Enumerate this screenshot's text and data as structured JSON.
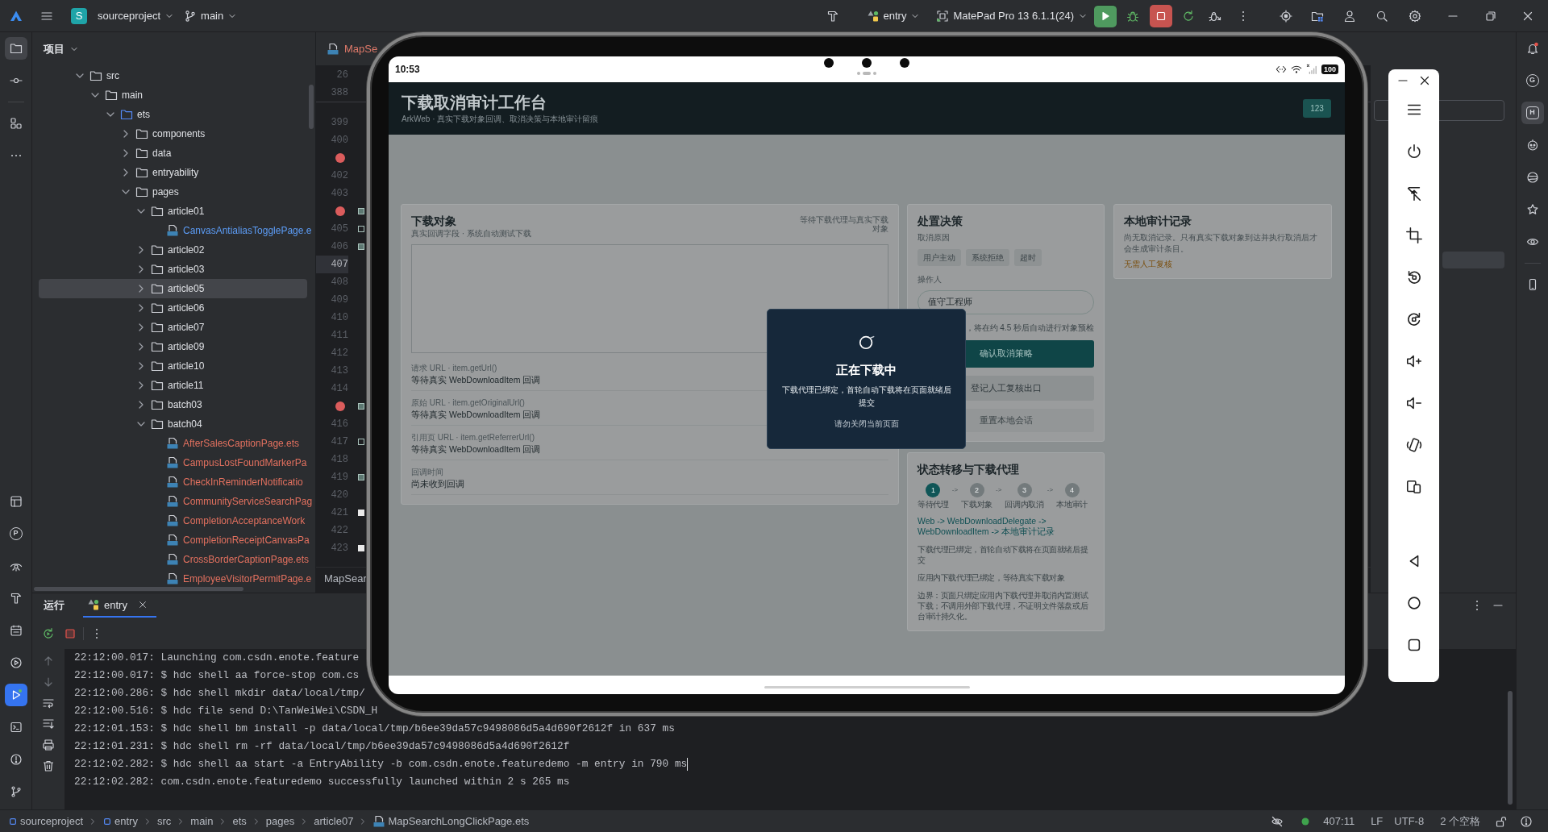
{
  "top_bar": {
    "project_letter": "S",
    "project": "sourceproject",
    "branch": "main",
    "run_config": "entry",
    "device": "MatePad Pro 13 6.1.1(24)"
  },
  "left_toolbar": {
    "top": [
      {
        "selected": true
      },
      {
        "selected": false
      },
      {
        "selected": false
      },
      {
        "selected": false
      }
    ],
    "bottom": [
      {
        "selected": false
      },
      {
        "letter": "P",
        "selected": false
      },
      {
        "selected": false
      },
      {
        "selected": false
      },
      {
        "selected": false
      },
      {
        "selected": false
      },
      {
        "selected": true
      },
      {
        "selected": false
      },
      {
        "selected": false
      },
      {
        "selected": false
      }
    ]
  },
  "project": {
    "title": "项目",
    "tree": [
      {
        "kind": "folder",
        "label": "src",
        "expanded": true,
        "selected": false,
        "children": [
          {
            "kind": "folder",
            "label": "main",
            "expanded": true,
            "selected": false,
            "children": [
              {
                "kind": "source_root",
                "label": "ets",
                "expanded": true,
                "selected": false,
                "children": [
                  {
                    "kind": "folder",
                    "label": "components",
                    "expanded": false,
                    "selected": false
                  },
                  {
                    "kind": "folder",
                    "label": "data",
                    "expanded": false,
                    "selected": false
                  },
                  {
                    "kind": "folder",
                    "label": "entryability",
                    "expanded": false,
                    "selected": false
                  },
                  {
                    "kind": "folder",
                    "label": "pages",
                    "expanded": true,
                    "selected": false,
                    "children": [
                      {
                        "kind": "folder",
                        "label": "article01",
                        "expanded": true,
                        "selected": false,
                        "children": [
                          {
                            "kind": "file",
                            "label": "CanvasAntialiasTogglePage.e",
                            "color": "#5c9cf5",
                            "selected": false
                          }
                        ]
                      },
                      {
                        "kind": "folder",
                        "label": "article02",
                        "expanded": false,
                        "selected": false
                      },
                      {
                        "kind": "folder",
                        "label": "article03",
                        "expanded": false,
                        "selected": false
                      },
                      {
                        "kind": "folder",
                        "label": "article05",
                        "expanded": false,
                        "selected": true
                      },
                      {
                        "kind": "folder",
                        "label": "article06",
                        "expanded": false,
                        "selected": false
                      },
                      {
                        "kind": "folder",
                        "label": "article07",
                        "expanded": false,
                        "selected": false
                      },
                      {
                        "kind": "folder",
                        "label": "article09",
                        "expanded": false,
                        "selected": false
                      },
                      {
                        "kind": "folder",
                        "label": "article10",
                        "expanded": false,
                        "selected": false
                      },
                      {
                        "kind": "folder",
                        "label": "article11",
                        "expanded": false,
                        "selected": false
                      },
                      {
                        "kind": "folder",
                        "label": "batch03",
                        "expanded": false,
                        "selected": false
                      },
                      {
                        "kind": "folder",
                        "label": "batch04",
                        "expanded": true,
                        "selected": false,
                        "children": [
                          {
                            "kind": "file",
                            "label": "AfterSalesCaptionPage.ets",
                            "color": "#e3715f",
                            "selected": false
                          },
                          {
                            "kind": "file",
                            "label": "CampusLostFoundMarkerPa",
                            "color": "#e3715f",
                            "selected": false
                          },
                          {
                            "kind": "file",
                            "label": "CheckInReminderNotificatio",
                            "color": "#e3715f",
                            "selected": false
                          },
                          {
                            "kind": "file",
                            "label": "CommunityServiceSearchPag",
                            "color": "#e3715f",
                            "selected": false
                          },
                          {
                            "kind": "file",
                            "label": "CompletionAcceptanceWork",
                            "color": "#e3715f",
                            "selected": false
                          },
                          {
                            "kind": "file",
                            "label": "CompletionReceiptCanvasPa",
                            "color": "#e3715f",
                            "selected": false
                          },
                          {
                            "kind": "file",
                            "label": "CrossBorderCaptionPage.ets",
                            "color": "#e3715f",
                            "selected": false
                          },
                          {
                            "kind": "file",
                            "label": "EmployeeVisitorPermitPage.e",
                            "color": "#e3715f",
                            "selected": false
                          }
                        ]
                      }
                    ]
                  }
                ]
              }
            ]
          }
        ]
      }
    ]
  },
  "editor": {
    "tab": "MapSe",
    "sticky_lines": [
      "26",
      "388"
    ],
    "gutter": [
      {
        "kind": "number",
        "text": "399",
        "current": false
      },
      {
        "kind": "number",
        "text": "400",
        "current": false
      },
      {
        "kind": "breakpoint",
        "current": false
      },
      {
        "kind": "number",
        "text": "402",
        "current": false
      },
      {
        "kind": "number",
        "text": "403",
        "current": false
      },
      {
        "kind": "breakpoint",
        "current": false,
        "marker": {
          "kind": "filled"
        }
      },
      {
        "kind": "number",
        "text": "405",
        "current": false,
        "marker": {
          "kind": "outline"
        }
      },
      {
        "kind": "number",
        "text": "406",
        "current": false,
        "marker": {
          "kind": "filled"
        }
      },
      {
        "kind": "number",
        "text": "407",
        "current": true
      },
      {
        "kind": "number",
        "text": "408",
        "current": false
      },
      {
        "kind": "number",
        "text": "409",
        "current": false
      },
      {
        "kind": "number",
        "text": "410",
        "current": false
      },
      {
        "kind": "number",
        "text": "411",
        "current": false
      },
      {
        "kind": "number",
        "text": "412",
        "current": false
      },
      {
        "kind": "number",
        "text": "413",
        "current": false
      },
      {
        "kind": "number",
        "text": "414",
        "current": false
      },
      {
        "kind": "breakpoint",
        "current": false,
        "marker": {
          "kind": "filled"
        }
      },
      {
        "kind": "number",
        "text": "416",
        "current": false
      },
      {
        "kind": "number",
        "text": "417",
        "current": false,
        "marker": {
          "kind": "outline"
        }
      },
      {
        "kind": "number",
        "text": "418",
        "current": false
      },
      {
        "kind": "number",
        "text": "419",
        "current": false,
        "marker": {
          "kind": "filled"
        }
      },
      {
        "kind": "number",
        "text": "420",
        "current": false
      },
      {
        "kind": "number",
        "text": "421",
        "current": false,
        "marker": {
          "kind": "solid"
        }
      },
      {
        "kind": "number",
        "text": "422",
        "current": false
      },
      {
        "kind": "number",
        "text": "423",
        "current": false,
        "marker": {
          "kind": "solid"
        }
      }
    ],
    "breadcrumb": "MapSear"
  },
  "emulator": {
    "status_bar": {
      "time": "10:53",
      "battery": "100"
    },
    "app": {
      "title": "下载取消审计工作台",
      "subtitle": "ArkWeb · 真实下载对象回调、取消决策与本地审计留痕",
      "badge": "123",
      "download_card": {
        "title": "下载对象",
        "subtitle": "真实回调字段 · 系统自动测试下载",
        "status": "等待下载代理与真实下载对象",
        "fields": [
          {
            "label": "请求 URL · item.getUrl()",
            "value": "等待真实 WebDownloadItem 回调"
          },
          {
            "label": "原始 URL · item.getOriginalUrl()",
            "value": "等待真实 WebDownloadItem 回调"
          },
          {
            "label": "引用页 URL · item.getReferrerUrl()",
            "value": "等待真实 WebDownloadItem 回调"
          },
          {
            "label": "回调时间",
            "value": "尚未收到回调"
          }
        ]
      },
      "decision_card": {
        "title": "处置决策",
        "reason_label": "取消原因",
        "reasons": [
          {
            "label": "用户主动",
            "selected": false
          },
          {
            "label": "系统拒绝",
            "selected": false
          },
          {
            "label": "超时",
            "selected": false
          }
        ],
        "operator_label": "操作人",
        "operator": "值守工程师",
        "hint": "，将在约 4.5 秒后自动进行对象预检",
        "buttons": [
          {
            "label": "确认取消策略",
            "kind": "primary"
          },
          {
            "label": "登记人工复核出口",
            "kind": "secondary"
          },
          {
            "label": "重置本地会话",
            "kind": "tertiary"
          }
        ]
      },
      "audit_card": {
        "title": "本地审计记录",
        "text": "尚无取消记录。只有真实下载对象到达并执行取消后才会生成审计条目。",
        "review": "无需人工复核"
      },
      "state_card": {
        "title": "状态转移与下载代理",
        "steps": [
          {
            "number": "1",
            "label": "等待代理",
            "selected": true,
            "arrow": "->"
          },
          {
            "number": "2",
            "label": "下载对象",
            "selected": false,
            "arrow": "->"
          },
          {
            "number": "3",
            "label": "回调内取消",
            "selected": false,
            "arrow": "->"
          },
          {
            "number": "4",
            "label": "本地审计",
            "selected": false
          }
        ],
        "flow": "Web -> WebDownloadDelegate -> WebDownloadItem -> 本地审计记录",
        "notes": [
          "下载代理已绑定，首轮自动下载将在页面就绪后提交",
          "应用内下载代理已绑定，等待真实下载对象",
          "边界：页面只绑定应用内下载代理并取消内置测试下载；不调用外部下载代理，不证明文件落盘或后台审计持久化。"
        ]
      }
    },
    "dialog": {
      "title": "正在下载中",
      "message": "下载代理已绑定，首轮自动下载将在页面就绪后提交",
      "note": "请勿关闭当前页面"
    }
  },
  "side_panel": {
    "rows": [
      {
        "selected": true
      }
    ]
  },
  "right_toolbar": [
    {
      "selected": false
    },
    {
      "letter": "G",
      "selected": false
    },
    {
      "letter": "H",
      "selected": true
    },
    {
      "selected": false
    },
    {
      "selected": false
    },
    {
      "selected": false
    },
    {
      "selected": false
    },
    {
      "selected": false
    }
  ],
  "run_panel": {
    "title": "运行",
    "tabs": [
      {
        "label": "entry",
        "selected": true
      }
    ],
    "console": [
      {
        "text": "22:12:00.017: Launching com.csdn.enote.feature",
        "caret": false
      },
      {
        "text": "22:12:00.017: $ hdc shell aa force-stop com.cs",
        "caret": false
      },
      {
        "text": "22:12:00.286: $ hdc shell mkdir data/local/tmp/",
        "caret": false
      },
      {
        "text": "22:12:00.516: $ hdc file send D:\\TanWeiWei\\CSDN_H",
        "caret": false
      },
      {
        "text": "22:12:01.153: $ hdc shell bm install -p data/local/tmp/b6ee39da57c9498086d5a4d690f2612f in 637 ms",
        "caret": false
      },
      {
        "text": "22:12:01.231: $ hdc shell rm -rf data/local/tmp/b6ee39da57c9498086d5a4d690f2612f",
        "caret": false
      },
      {
        "text": "22:12:02.282: $ hdc shell aa start -a EntryAbility -b com.csdn.enote.featuredemo -m entry in 790 ms",
        "caret": true
      },
      {
        "text": "22:12:02.282: com.csdn.enote.featuredemo successfully launched within 2 s 265 ms",
        "caret": false
      }
    ]
  },
  "status_bar": {
    "breadcrumbs": [
      {
        "kind": "module",
        "label": "sourceproject"
      },
      {
        "kind": "module",
        "label": "entry"
      },
      {
        "kind": "folder",
        "label": "src"
      },
      {
        "kind": "folder",
        "label": "main"
      },
      {
        "kind": "folder",
        "label": "ets"
      },
      {
        "kind": "folder",
        "label": "pages"
      },
      {
        "kind": "folder",
        "label": "article07"
      },
      {
        "kind": "file",
        "label": "MapSearchLongClickPage.ets"
      }
    ],
    "position": "407:11",
    "line_ending": "LF",
    "encoding": "UTF-8",
    "indent": "2 个空格"
  }
}
